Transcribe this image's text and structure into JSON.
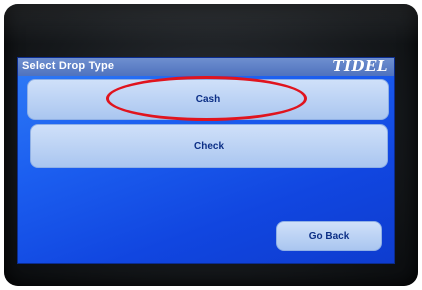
{
  "screen": {
    "title": "Select Drop Type",
    "logo_text": "TIDEL",
    "buttons": {
      "cash": "Cash",
      "check": "Check",
      "go_back": "Go Back"
    }
  },
  "colors": {
    "screen_blue": "#1c5ff0",
    "button_face": "#bcd3f5",
    "button_text": "#0c2f86",
    "annotation_red": "#e0141e"
  }
}
